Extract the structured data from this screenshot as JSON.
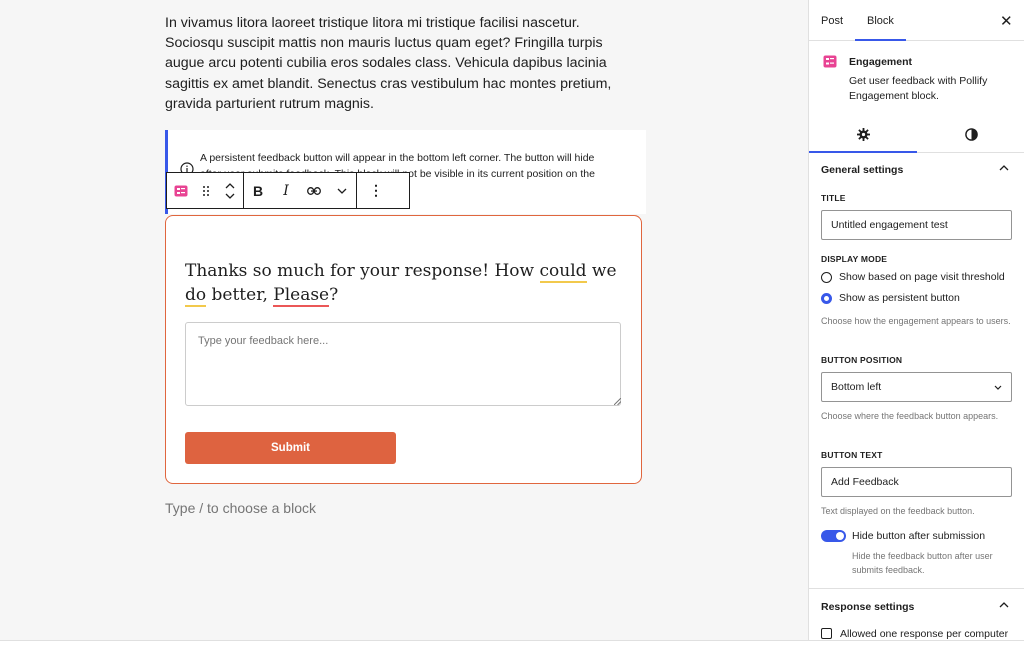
{
  "editor": {
    "paragraph": "In vivamus litora laoreet tristique litora mi tristique facilisi nascetur. Sociosqu suscipit mattis non mauris luctus quam eget? Fringilla turpis augue arcu potenti cubilia eros sodales class. Vehicula dapibus lacinia sagittis ex amet blandit. Senectus cras vestibulum hac montes pretium, gravida parturient rutrum magnis.",
    "notice_line1": "A persistent feedback button will appear in the bottom left corner. The button will hide",
    "notice_line2": "after user submits feedback. This block will not be visible in its current position on the",
    "form": {
      "title_part1": "Thanks so much for your response! How ",
      "title_word_could": "could",
      "title_part2": " we ",
      "title_word_do": "do",
      "title_part3": " better, ",
      "title_word_please": "Please",
      "title_part4": "?",
      "feedback_placeholder": "Type your feedback here...",
      "submit_label": "Submit"
    },
    "appender": "Type / to choose a block",
    "toolbar": {
      "bold": "B",
      "italic": "I",
      "more": "⋮"
    }
  },
  "sidebar": {
    "tabs": [
      "Post",
      "Block"
    ],
    "active_tab": "Block",
    "close": "✕",
    "block": {
      "title": "Engagement",
      "description": "Get user feedback with Pollify Engagement block."
    },
    "general": {
      "heading": "General settings",
      "title_label": "TITLE",
      "title_value": "Untitled engagement test",
      "display_mode_label": "DISPLAY MODE",
      "display_mode_options": [
        "Show based on page visit threshold",
        "Show as persistent button"
      ],
      "display_mode_selected": "Show as persistent button",
      "display_mode_help": "Choose how the engagement appears to users.",
      "button_position_label": "BUTTON POSITION",
      "button_position_value": "Bottom left",
      "button_position_help": "Choose where the feedback button appears.",
      "button_text_label": "BUTTON TEXT",
      "button_text_value": "Add Feedback",
      "button_text_help": "Text displayed on the feedback button.",
      "hide_toggle_label": "Hide button after submission",
      "hide_toggle_help": "Hide the feedback button after user submits feedback.",
      "hide_toggle_on": true
    },
    "response": {
      "heading": "Response settings",
      "checkbox_label": "Allowed one response per computer"
    }
  },
  "colors": {
    "accent": "#3858e9",
    "form_border": "#e0663e",
    "submit_bg": "#de6340",
    "block_icon": "#e84393"
  }
}
